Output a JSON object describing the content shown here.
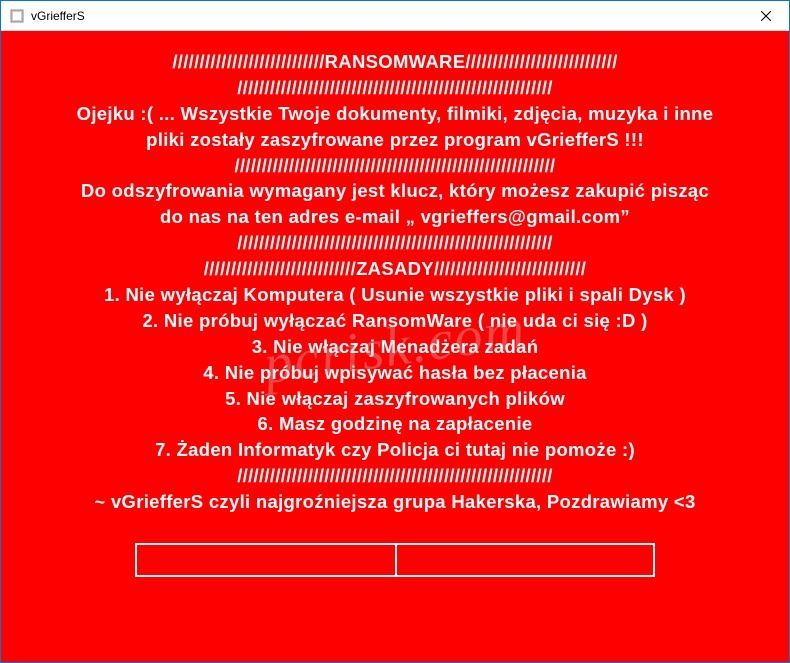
{
  "window": {
    "title": "vGriefferS",
    "close_label": "×"
  },
  "lines": {
    "l0": "////////////////////////////RANSOMWARE////////////////////////////",
    "l1": "//////////////////////////////////////////////////////////",
    "l2": "Ojejku :( ... Wszystkie Twoje dokumenty, filmiki, zdjęcia, muzyka i inne",
    "l3": "pliki zostały zaszyfrowane  przez program vGriefferS !!!",
    "l4": "///////////////////////////////////////////////////////////",
    "l5": "Do odszyfrowania wymagany jest klucz, który możesz zakupić pisząc",
    "l6": "do nas na ten adres e-mail „ vgrieffers@gmail.com”",
    "l7": "//////////////////////////////////////////////////////////",
    "l8": "////////////////////////////ZASADY////////////////////////////",
    "l9": "1. Nie wyłączaj Komputera ( Usunie wszystkie pliki i spali Dysk )",
    "l10": "2. Nie próbuj wyłączać RansomWare ( nie uda ci się :D )",
    "l11": "3. Nie włączaj Menadżera zadań",
    "l12": "4. Nie próbuj wpisywać hasła bez płacenia",
    "l13": "5. Nie włączaj zaszyfrowanych plików",
    "l14": "6. Masz godzinę na zapłacenie",
    "l15": "7. Żaden Informatyk czy Policja ci tutaj nie pomoże :)",
    "l16": "//////////////////////////////////////////////////////////",
    "l17": "~ vGriefferS czyli najgroźniejsza grupa Hakerska, Pozdrawiamy <3"
  },
  "watermark": "pcrisk.com"
}
